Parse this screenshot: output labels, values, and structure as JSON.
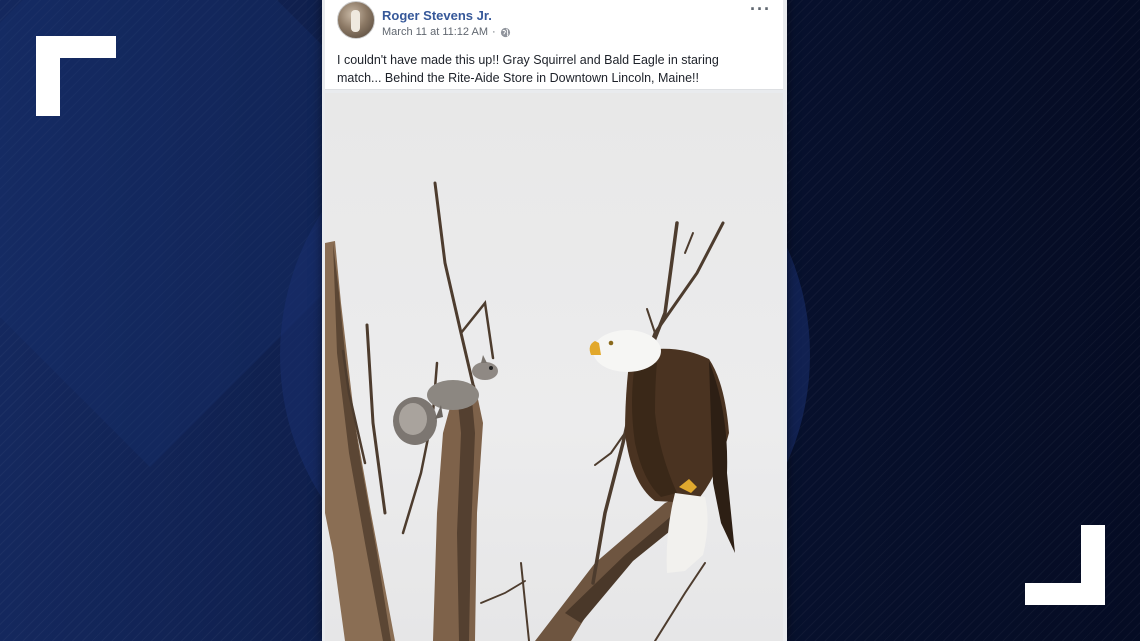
{
  "post": {
    "author": "Roger Stevens Jr.",
    "date": "March 11 at 11:12 AM",
    "privacy_icon": "globe-icon",
    "more_icon": "more-options-icon",
    "caption": "I couldn't have made this up!! Gray Squirrel and Bald Eagle in staring match... Behind the Rite-Aide Store in Downtown Lincoln, Maine!!"
  },
  "colors": {
    "author_link": "#365899",
    "background": "#0a1533",
    "corner_brackets": "#ffffff"
  }
}
